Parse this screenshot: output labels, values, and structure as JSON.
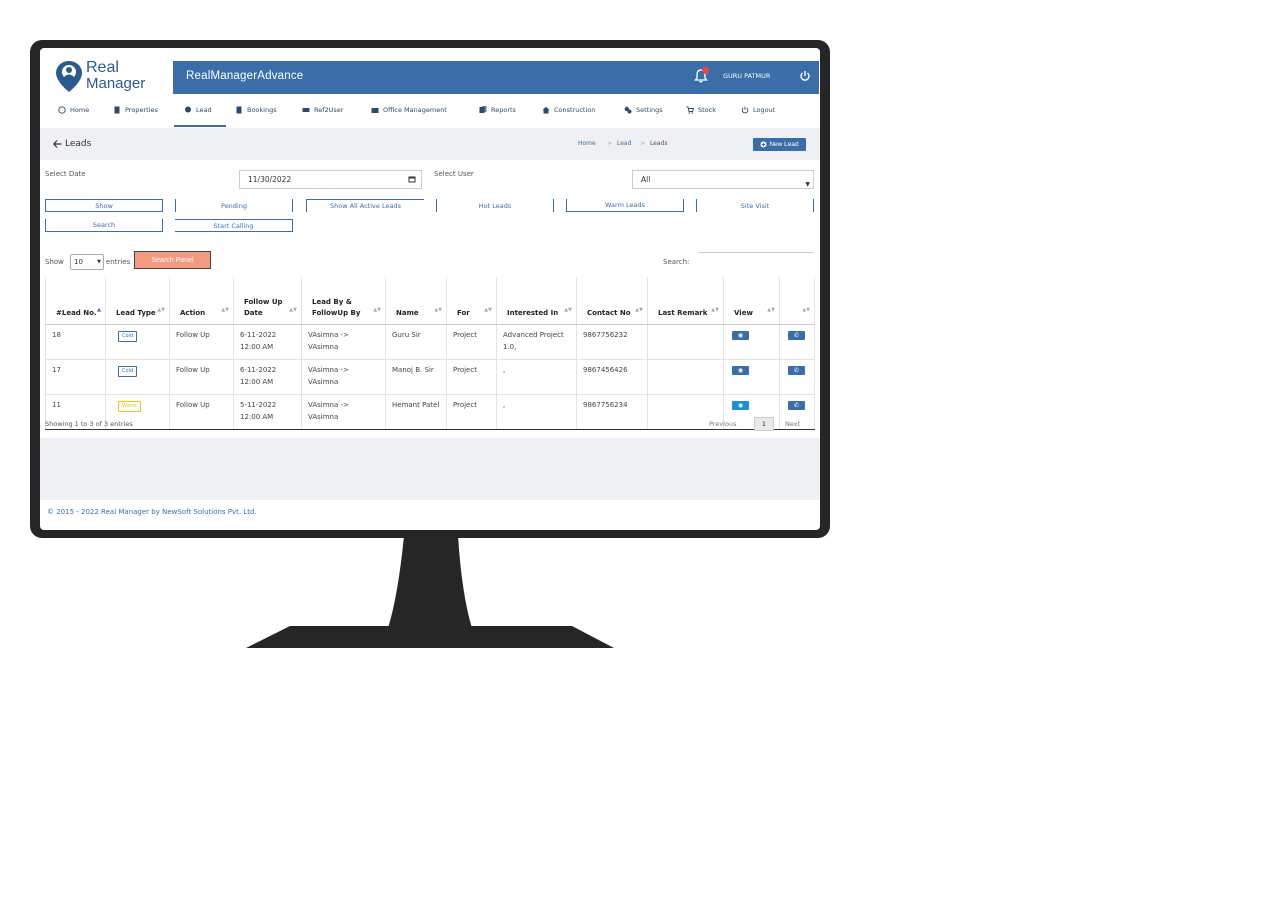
{
  "brand": {
    "logo_line1": "Real",
    "logo_line2": "Manager",
    "app_title": "RealManagerAdvance"
  },
  "header": {
    "user": "GURU PATMUR"
  },
  "nav": [
    {
      "label": "Home",
      "icon": "home-icon"
    },
    {
      "label": "Properties",
      "icon": "building-icon"
    },
    {
      "label": "Lead",
      "icon": "pin-icon"
    },
    {
      "label": "Bookings",
      "icon": "document-icon"
    },
    {
      "label": "Ref2User",
      "icon": "card-icon"
    },
    {
      "label": "Office Management",
      "icon": "briefcase-icon"
    },
    {
      "label": "Reports",
      "icon": "copy-icon"
    },
    {
      "label": "Construction",
      "icon": "house-icon"
    },
    {
      "label": "Settings",
      "icon": "gears-icon"
    },
    {
      "label": "Stock",
      "icon": "cart-icon"
    },
    {
      "label": "Logout",
      "icon": "power-icon"
    }
  ],
  "page": {
    "title": "Leads",
    "breadcrumb": [
      "Home",
      "Lead",
      "Leads"
    ],
    "new_lead": "New Lead"
  },
  "filters": {
    "date_label": "Select Date",
    "date_value": "11/30/2022",
    "user_label": "Select User",
    "user_value": "All",
    "buttons": [
      "Show",
      "Pending",
      "Show All Active Leads",
      "Hot Leads",
      "Warm Leads",
      "Site Visit",
      "Search",
      "Start Calling"
    ]
  },
  "list": {
    "show": "Show",
    "entries_value": "10",
    "entries": "entries",
    "search_panel": "Search Panel",
    "search": "Search:"
  },
  "table": {
    "headers": [
      "#Lead No.",
      "Lead Type",
      "Action",
      "Follow Up Date",
      "Lead By & FollowUp By",
      "Name",
      "For",
      "Interested In",
      "Contact No",
      "Last Remark",
      "View",
      ""
    ],
    "rows": [
      {
        "no": "18",
        "type": "Cold",
        "action": "Follow Up",
        "date": "6-11-2022 12:00 AM",
        "by": "VAsimna -> VAsimna",
        "name": "Guru Sir",
        "for": "Project",
        "interested": "Advanced Project 1.0,",
        "contact": "9867756232",
        "remark": ""
      },
      {
        "no": "17",
        "type": "Cold",
        "action": "Follow Up",
        "date": "6-11-2022 12:00 AM",
        "by": "VAsimna -> VAsimna",
        "name": "Manoj B. Sir",
        "for": "Project",
        "interested": ",",
        "contact": "9867456426",
        "remark": ""
      },
      {
        "no": "11",
        "type": "Warm",
        "action": "Follow Up",
        "date": "5-11-2022 12:00 AM",
        "by": "VAsimna -> VAsimna",
        "name": "Hemant Patel",
        "for": "Project",
        "interested": ",",
        "contact": "9867756234",
        "remark": ""
      }
    ]
  },
  "pager": {
    "info": "Showing 1 to 3 of 3 entries",
    "prev": "Previous",
    "page": "1",
    "next": "Next"
  },
  "footer": {
    "copyright": "© 2015 - 2022 Real Manager by NewSoft Solutions Pvt. Ltd."
  }
}
